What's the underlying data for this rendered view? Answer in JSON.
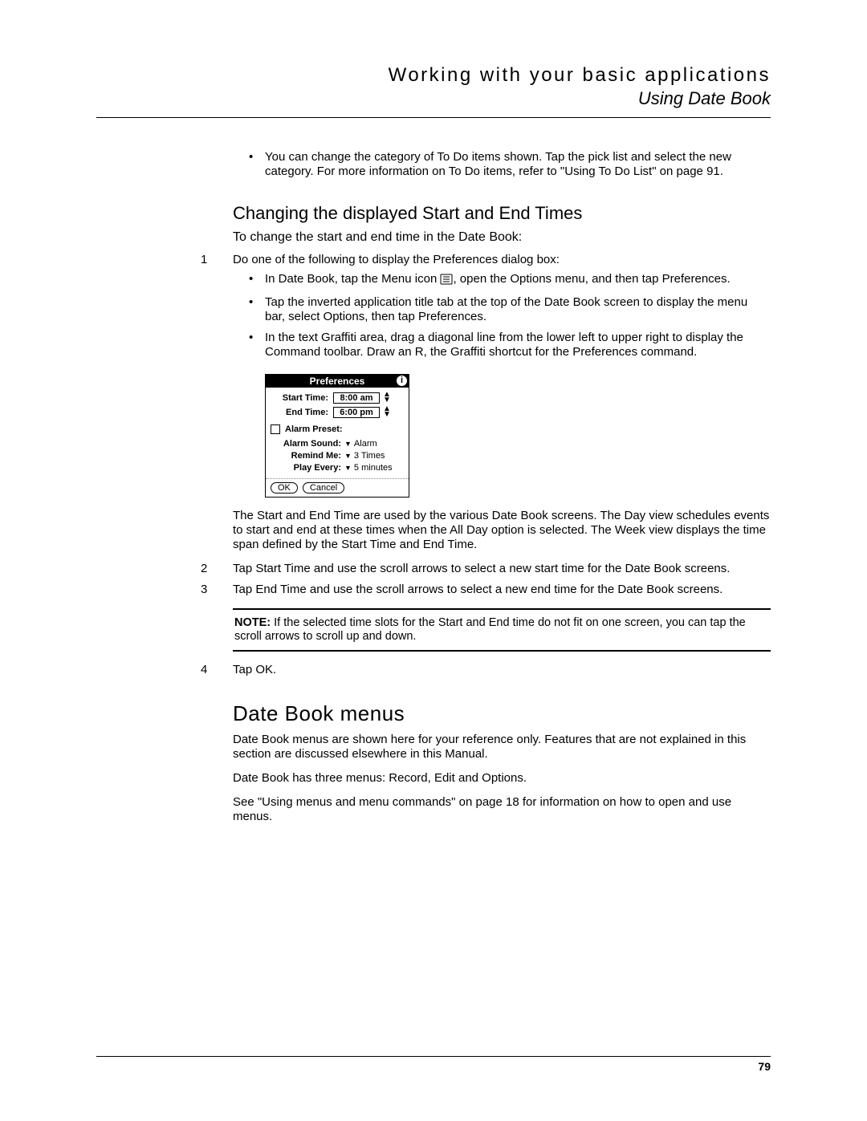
{
  "header": {
    "chapter_title": "Working with your basic applications",
    "section_title": "Using Date Book"
  },
  "top_bullet": "You can change the category of To Do items shown. Tap the pick list and select the new category. For more information on To Do items, refer to \"Using To Do List\" on page 91.",
  "heading_change": "Changing the displayed Start and End Times",
  "intro_change": "To change the start and end time in the Date Book:",
  "step1": {
    "num": "1",
    "text": "Do one of the following to display the Preferences dialog box:",
    "bullets": [
      {
        "before": "In Date Book, tap the Menu icon ",
        "after": ", open the Options menu, and then tap Preferences."
      },
      {
        "before": "Tap the inverted application title tab at the top of the Date Book screen to display the menu bar, select Options, then tap Preferences.",
        "after": ""
      },
      {
        "before": "In the text Graffiti area, drag a diagonal line from the lower left to upper right to display the Command toolbar. Draw an R, the Graffiti shortcut for the Preferences command.",
        "after": ""
      }
    ]
  },
  "palm": {
    "title": "Preferences",
    "info": "i",
    "start_label": "Start Time:",
    "start_value": "8:00 am",
    "end_label": "End Time:",
    "end_value": "6:00 pm",
    "alarm_preset": "Alarm Preset:",
    "alarm_sound_label": "Alarm Sound:",
    "alarm_sound_value": "Alarm",
    "remind_label": "Remind Me:",
    "remind_value": "3 Times",
    "play_label": "Play Every:",
    "play_value": "5 minutes",
    "ok": "OK",
    "cancel": "Cancel"
  },
  "after_image_para": "The Start and End Time are used by the various Date Book screens. The Day view schedules events to start and end at these times when the All Day option is selected. The Week view displays the time span defined by the Start Time and End Time.",
  "step2": {
    "num": "2",
    "text": "Tap Start Time and use the scroll arrows to select a new start time for the Date Book screens."
  },
  "step3": {
    "num": "3",
    "text": "Tap End Time and use the scroll arrows to select a new end time for the Date Book screens."
  },
  "note": {
    "label": "NOTE:",
    "text": "  If the selected time slots for the Start and End time do not fit on one screen, you can tap the scroll arrows to scroll up and down."
  },
  "step4": {
    "num": "4",
    "text": "Tap OK."
  },
  "heading_menus": "Date Book menus",
  "menus_p1": "Date Book menus are shown here for your reference only. Features that are not explained in this section are discussed elsewhere in this Manual.",
  "menus_p2": "Date Book has three menus: Record, Edit and Options.",
  "menus_p3": "See \"Using menus and menu commands\" on page 18 for information on how to open and use menus.",
  "page_number": "79"
}
